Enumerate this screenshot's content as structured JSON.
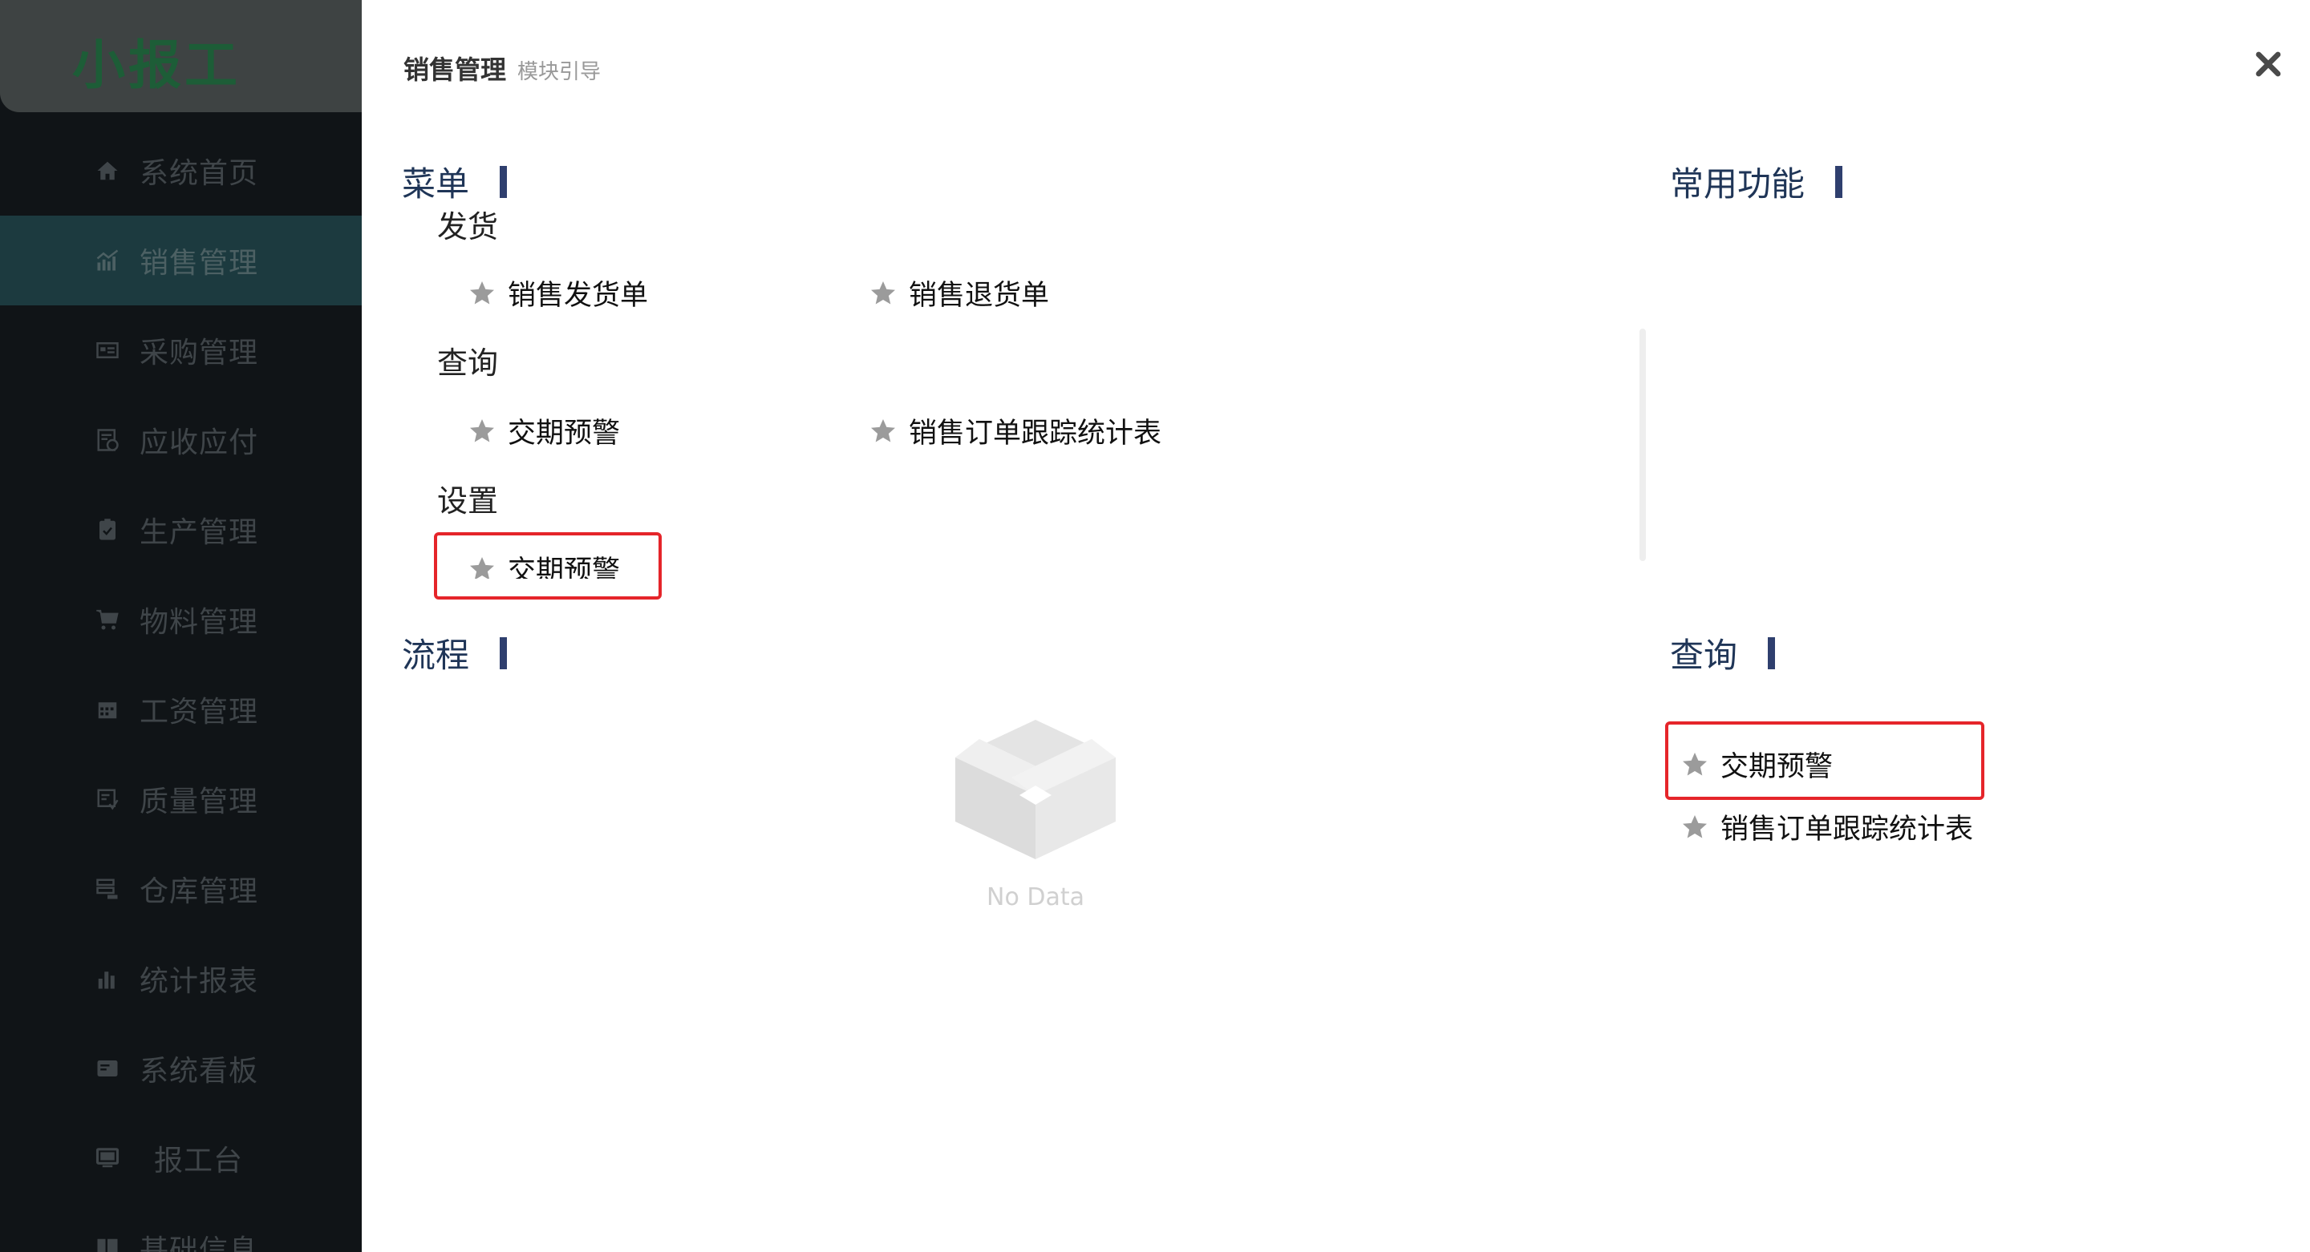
{
  "app": {
    "logo": "小报工"
  },
  "sidebar": {
    "items": [
      {
        "label": "系统首页",
        "icon": "home-icon",
        "active": false
      },
      {
        "label": "销售管理",
        "icon": "chart-icon",
        "active": true
      },
      {
        "label": "采购管理",
        "icon": "purchase-icon",
        "active": false
      },
      {
        "label": "应收应付",
        "icon": "ledger-icon",
        "active": false
      },
      {
        "label": "生产管理",
        "icon": "clipboard-icon",
        "active": false
      },
      {
        "label": "物料管理",
        "icon": "cart-icon",
        "active": false
      },
      {
        "label": "工资管理",
        "icon": "calendar-icon",
        "active": false
      },
      {
        "label": "质量管理",
        "icon": "quality-icon",
        "active": false
      },
      {
        "label": "仓库管理",
        "icon": "warehouse-icon",
        "active": false
      },
      {
        "label": "统计报表",
        "icon": "bar-chart-icon",
        "active": false
      },
      {
        "label": "系统看板",
        "icon": "board-icon",
        "active": false
      },
      {
        "label": "报工台",
        "icon": "monitor-icon",
        "active": false
      },
      {
        "label": "基础信息",
        "icon": "grid-icon",
        "active": false
      }
    ]
  },
  "panel": {
    "title": "销售管理",
    "subtitle": "模块引导",
    "close_icon": "close-icon",
    "menu": {
      "title": "菜单",
      "groups": [
        {
          "name": "发货",
          "items": [
            "销售发货单",
            "销售退货单"
          ]
        },
        {
          "name": "查询",
          "items": [
            "交期预警",
            "销售订单跟踪统计表"
          ]
        },
        {
          "name": "设置",
          "items": [
            "交期预警"
          ]
        }
      ]
    },
    "flow": {
      "title": "流程",
      "empty_text": "No Data"
    },
    "common": {
      "title": "常用功能"
    },
    "query": {
      "title": "查询",
      "items": [
        "交期预警",
        "销售订单跟踪统计表"
      ]
    }
  },
  "colors": {
    "sidebar_bg": "#101417",
    "sidebar_active": "#1c3a3f",
    "logo": "#1d5d37",
    "section_title": "#1f3557",
    "section_bar": "#2f3f6e",
    "star": "#9b9b9b",
    "highlight": "#e5252a"
  }
}
